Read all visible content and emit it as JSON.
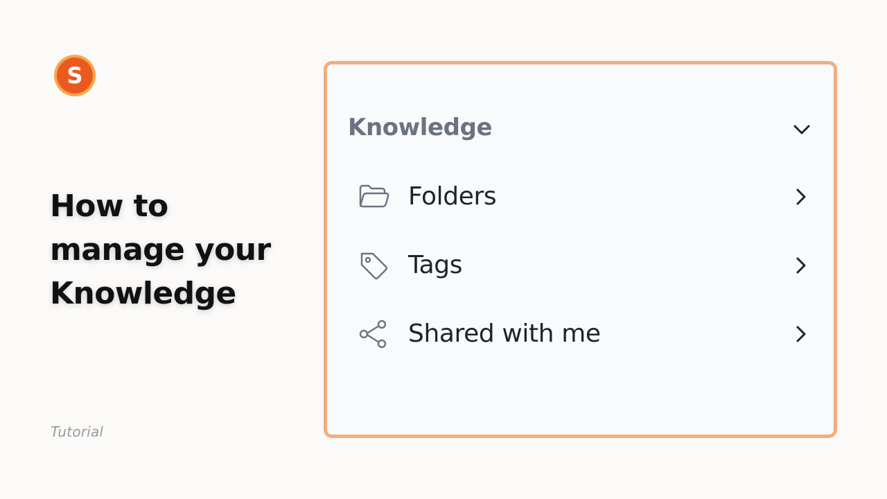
{
  "brand": {
    "logo_letter": "S",
    "logo_color": "#ea5a1f"
  },
  "intro": {
    "title_lines": [
      "How to",
      "manage your",
      "Knowledge"
    ],
    "subtitle": "Tutorial"
  },
  "panel": {
    "border_color": "#f2ad7f",
    "section": {
      "title": "Knowledge",
      "icon": "chevron-down-icon"
    },
    "items": [
      {
        "label": "Folders",
        "icon": "folder-icon",
        "action_icon": "chevron-right-icon"
      },
      {
        "label": "Tags",
        "icon": "tag-icon",
        "action_icon": "chevron-right-icon"
      },
      {
        "label": "Shared with me",
        "icon": "share-icon",
        "action_icon": "chevron-right-icon"
      }
    ]
  }
}
